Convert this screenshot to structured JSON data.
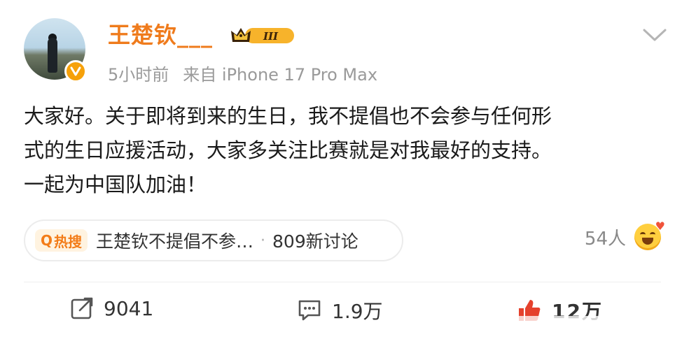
{
  "post": {
    "author": {
      "name": "王楚钦___",
      "vip_badge": "III",
      "verified_icon": "verified-v-icon"
    },
    "meta": {
      "time": "5小时前",
      "source": "来自 iPhone 17 Pro Max"
    },
    "text": "大家好。关于即将到来的生日，我不提倡也不会参与任何形\n式的生日应援活动，大家多关注比赛就是对我最好的支持。\n一起为中国队加油！",
    "topic": {
      "tag": "热搜",
      "title": "王楚钦不提倡不参…",
      "separator": "·",
      "discussion": "809新讨论"
    },
    "reactions": {
      "count": "54人",
      "emoji_icon": "love-face-emoji-icon"
    },
    "actions": {
      "repost": "9041",
      "comment": "1.9万",
      "like": "12万"
    }
  },
  "colors": {
    "name_orange": "#ef7b1c",
    "meta_gray": "#9a9a9a",
    "hot_orange": "#f37c18",
    "like_red": "#e5412d"
  }
}
